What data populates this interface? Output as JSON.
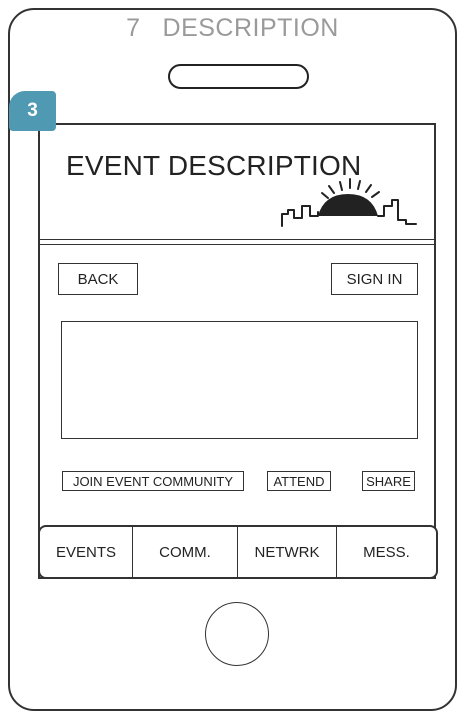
{
  "page": {
    "screen_number": "7",
    "screen_name": "DESCRIPTION",
    "step_badge": "3"
  },
  "header": {
    "title": "EVENT DESCRIPTION",
    "logo_icon": "city-skyline-sunrise-icon"
  },
  "actions": {
    "back_label": "BACK",
    "sign_in_label": "SIGN IN",
    "join_label": "JOIN EVENT COMMUNITY",
    "attend_label": "ATTEND",
    "share_label": "SHARE"
  },
  "nav": {
    "items": [
      {
        "label": "EVENTS"
      },
      {
        "label": "COMM."
      },
      {
        "label": "NETWRK"
      },
      {
        "label": "MESS."
      }
    ]
  },
  "colors": {
    "badge": "#4f99b3",
    "title_gray": "#9a9a9a",
    "outline": "#333333"
  }
}
